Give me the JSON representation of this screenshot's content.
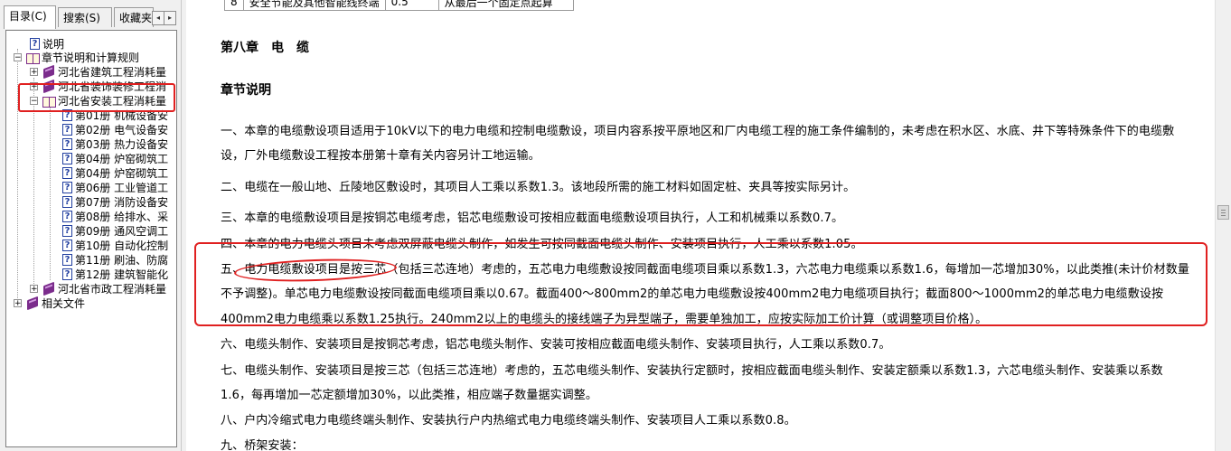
{
  "tabs": {
    "contents": "目录(C)",
    "search": "搜索(S)",
    "favorites": "收藏夹",
    "scroll_left": "◂",
    "scroll_right": "▸"
  },
  "tree": {
    "readme": "说明",
    "chapter_rules": "章节说明和计算规则",
    "building": "河北省建筑工程消耗量",
    "decoration": "河北省装饰装修工程消",
    "installation": "河北省安装工程消耗量",
    "volumes": [
      "第01册 机械设备安",
      "第02册 电气设备安",
      "第03册 热力设备安",
      "第04册 炉窑砌筑工",
      "第04册 炉窑砌筑工",
      "第06册 工业管道工",
      "第07册 消防设备安",
      "第08册 给排水、采",
      "第09册 通风空调工",
      "第10册 自动化控制",
      "第11册 刷油、防腐",
      "第12册 建筑智能化"
    ],
    "municipal": "河北省市政工程消耗量",
    "related": "相关文件"
  },
  "table_row": {
    "num": "8",
    "item": "安全节能及其他智能线终端",
    "value": "0.5",
    "desc": "从最后一个固定点起算"
  },
  "doc": {
    "chapter_title": "第八章　电　缆",
    "section_title": "章节说明",
    "paragraphs": [
      "一、本章的电缆敷设项目适用于10kV以下的电力电缆和控制电缆敷设，项目内容系按平原地区和厂内电缆工程的施工条件编制的，未考虑在积水区、水底、井下等特殊条件下的电缆敷设，厂外电缆敷设工程按本册第十章有关内容另计工地运输。",
      "二、电缆在一般山地、丘陵地区敷设时，其项目人工乘以系数1.3。该地段所需的施工材料如固定桩、夹具等按实际另计。",
      "三、本章的电缆敷设项目是按铜芯电缆考虑，铝芯电缆敷设可按相应截面电缆敷设项目执行，人工和机械乘以系数0.7。",
      "四、本章的电力电缆头项目未考虑双屏蔽电缆头制作，如发生可按同截面电缆头制作、安装项目执行，人工乘以系数1.05。",
      "五、电力电缆敷设项目是按三芯（包括三芯连地）考虑的，五芯电力电缆敷设按同截面电缆项目乘以系数1.3，六芯电力电缆乘以系数1.6，每增加一芯增加30%，以此类推(未计价材数量不予调整)。单芯电力电缆敷设按同截面电缆项目乘以0.67。截面400～800mm2的单芯电力电缆敷设按400mm2电力电缆项目执行；截面800～1000mm2的单芯电力电缆敷设按400mm2电力电缆乘以系数1.25执行。240mm2以上的电缆头的接线端子为异型端子，需要单独加工，应按实际加工价计算（或调整项目价格）。",
      "六、电缆头制作、安装项目是按铜芯考虑，铝芯电缆头制作、安装可按相应截面电缆头制作、安装项目执行，人工乘以系数0.7。",
      "七、电缆头制作、安装项目是按三芯（包括三芯连地）考虑的，五芯电缆头制作、安装执行定额时，按相应截面电缆头制作、安装定额乘以系数1.3，六芯电缆头制作、安装乘以系数1.6，每再增加一芯定额增加30%，以此类推，相应端子数量据实调整。",
      "八、户内冷缩式电力电缆终端头制作、安装执行户内热缩式电力电缆终端头制作、安装项目人工乘以系数0.8。",
      "九、桥架安装："
    ]
  },
  "annotation_color": "#e02020"
}
